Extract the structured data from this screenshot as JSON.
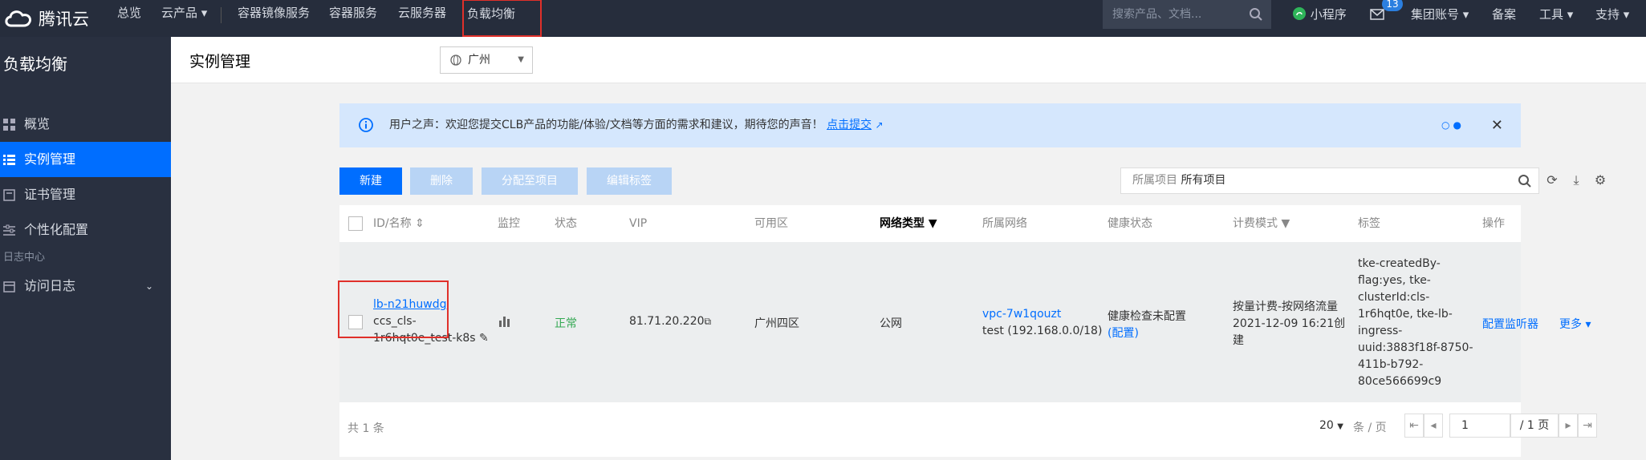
{
  "topbar": {
    "brand": "腾讯云",
    "nav": [
      {
        "label": "总览"
      },
      {
        "label": "云产品 ▾"
      },
      {
        "label": "容器镜像服务"
      },
      {
        "label": "容器服务"
      },
      {
        "label": "云服务器"
      },
      {
        "label": "负载均衡"
      }
    ],
    "search_placeholder": "搜索产品、文档...",
    "right": [
      {
        "label": "小程序"
      },
      {
        "label": "13"
      },
      {
        "label": "集团账号 ▾"
      },
      {
        "label": "备案"
      },
      {
        "label": "工具 ▾"
      },
      {
        "label": "支持 ▾"
      }
    ]
  },
  "sidebar": {
    "title": "负载均衡",
    "items": [
      {
        "label": "概览"
      },
      {
        "label": "实例管理"
      },
      {
        "label": "证书管理"
      },
      {
        "label": "个性化配置"
      }
    ],
    "section": "日志中心",
    "log_item": "访问日志"
  },
  "header": {
    "title": "实例管理",
    "region": "广州"
  },
  "notice": {
    "text": "用户之声：欢迎您提交CLB产品的功能/体验/文档等方面的需求和建议，期待您的声音！",
    "link": "点击提交"
  },
  "toolbar": {
    "new": "新建",
    "delete": "删除",
    "assign": "分配至项目",
    "edit_tags": "编辑标签",
    "filter_key": "所属项目",
    "filter_value": "所有项目"
  },
  "table": {
    "headers": [
      "ID/名称",
      "监控",
      "状态",
      "VIP",
      "可用区",
      "网络类型",
      "所属网络",
      "健康状态",
      "计费模式",
      "标签",
      "操作"
    ],
    "row": {
      "id": "lb-n21huwdg",
      "name": "ccs_cls-",
      "name2": "1r6hqt0e_test-k8s",
      "status": "正常",
      "vip": "81.71.20.220",
      "zone": "广州四区",
      "net_type": "公网",
      "vpc": "vpc-7w1qouzt",
      "vpc_desc": "test (192.168.0.0/18)",
      "health": "健康检查未配置",
      "health_link": "(配置)",
      "billing1": "按量计费-按网络流量",
      "billing2": "2021-12-09 16:21创",
      "billing3": "建",
      "tags": [
        "tke-createdBy-",
        "flag:yes, tke-",
        "clusterId:cls-",
        "1r6hqt0e, tke-lb-",
        "ingress-",
        "uuid:3883f18f-8750-",
        "411b-b792-",
        "80ce566699c9"
      ],
      "action": "配置监听器",
      "more": "更多 ▾"
    },
    "total": "共 1 条",
    "page_size": "20",
    "per_page": "条 / 页",
    "page_input": "1",
    "page_total": "/ 1 页"
  }
}
